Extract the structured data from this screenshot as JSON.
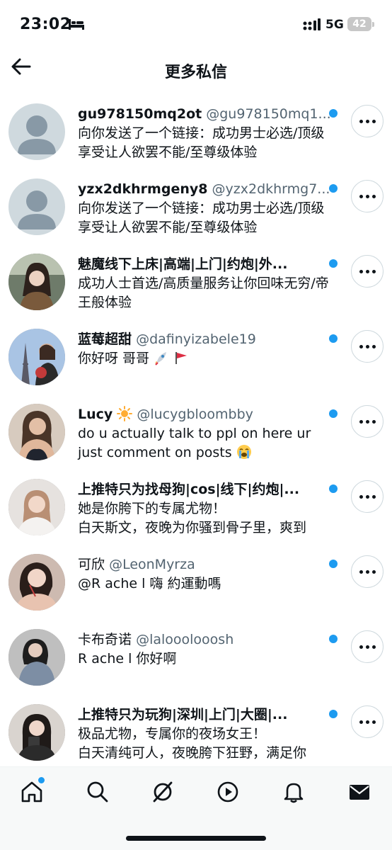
{
  "status_bar": {
    "time": "23:02",
    "network": "5G",
    "battery": "42"
  },
  "header": {
    "title": "更多私信"
  },
  "messages": [
    {
      "name": "gu978150mq2ot",
      "handle": "@gu978150mq1...",
      "text": "向你发送了一个链接：成功男士必选/顶级享受让人欲罢不能/至尊级体验",
      "avatar": "default-avatar"
    },
    {
      "name": "yzx2dkhrmgeny8",
      "handle": "@yzx2dkhrmg7...",
      "text": "向你发送了一个链接：成功男士必选/顶级享受让人欲罢不能/至尊级体验",
      "avatar": "default-avatar"
    },
    {
      "name": "魅魔线下上床|高端|上门|约炮|外...",
      "handle": "",
      "text": "成功人士首选/高质量服务让你回味无穷/帝王般体验",
      "avatar": "photo"
    },
    {
      "name": "蓝莓超甜",
      "handle": "@dafinyizabele19",
      "text": "你好呀 哥哥",
      "emoji": [
        "rocket-emoji",
        "flag-emoji"
      ],
      "avatar": "photo"
    },
    {
      "name": "Lucy",
      "name_emoji": "sun-emoji",
      "handle": "@lucygbloombby",
      "text": "do u actually talk to ppl on here ur just comment on posts",
      "emoji": [
        "crying-face-emoji"
      ],
      "avatar": "photo"
    },
    {
      "name": "上推特只为找母狗|cos|线下|约炮|...",
      "handle": "",
      "text": "她是你胯下的专属尤物！",
      "text2": "白天斯文，夜晚为你骚到骨子里，爽到",
      "avatar": "photo"
    },
    {
      "name": "可欣",
      "handle": "@LeonMyrza",
      "text": "@R ache l 嗨 約運動嗎",
      "avatar": "photo"
    },
    {
      "name": "卡布奇诺",
      "handle": "@lalooolooosh",
      "text": "R ache l 你好啊",
      "avatar": "photo"
    },
    {
      "name": "上推特只为玩狗|深圳|上门|大圈|...",
      "handle": "",
      "text": "极品尤物，专属你的夜场女王！",
      "text2": "白天清纯可人，夜晚胯下狂野，满足你",
      "avatar": "photo"
    }
  ],
  "bottom_nav": [
    "home-icon",
    "search-icon",
    "grok-icon",
    "play-icon",
    "bell-icon",
    "mail-icon"
  ],
  "colors": {
    "accent": "#1d9bf0",
    "text": "#0f1419",
    "secondary": "#536471"
  }
}
